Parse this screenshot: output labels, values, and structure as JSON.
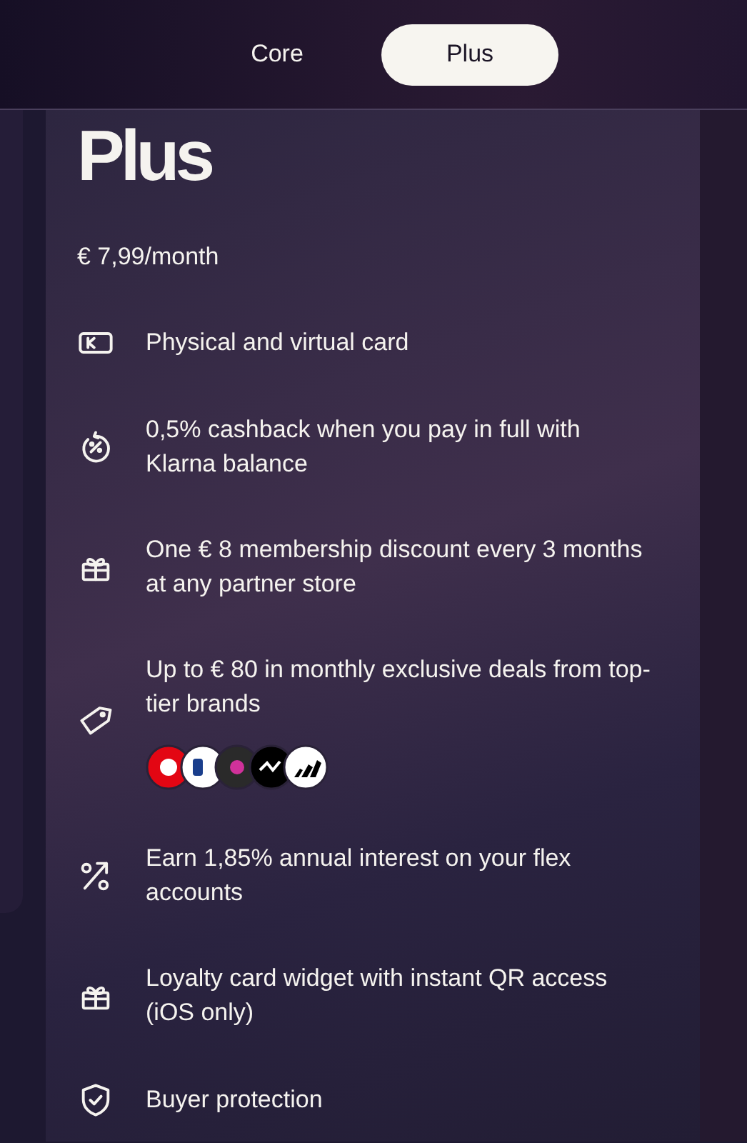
{
  "tabs": [
    {
      "label": "Core",
      "selected": false
    },
    {
      "label": "Plus",
      "selected": true
    }
  ],
  "plan": {
    "title": "Plus",
    "price": "€ 7,99/month"
  },
  "features": [
    {
      "kind": "card",
      "text": "Physical and virtual card"
    },
    {
      "kind": "cashback",
      "text": "0,5% cashback when you pay in full with Klarna balance"
    },
    {
      "kind": "gift",
      "text": "One € 8 membership discount every 3 months at any partner store"
    },
    {
      "kind": "tag",
      "text": "Up to € 80 in monthly exclusive deals from top-tier brands",
      "logos": [
        {
          "color": "#e30613"
        },
        {
          "color": "#ffffff"
        },
        {
          "color": "#2a2a2a"
        },
        {
          "color": "#000000"
        },
        {
          "color": "#ffffff"
        }
      ]
    },
    {
      "kind": "percent",
      "text": "Earn 1,85% annual interest on your flex accounts"
    },
    {
      "kind": "gift",
      "text": "Loyalty card widget with instant QR access (iOS only)"
    },
    {
      "kind": "shield",
      "text": "Buyer protection"
    }
  ]
}
